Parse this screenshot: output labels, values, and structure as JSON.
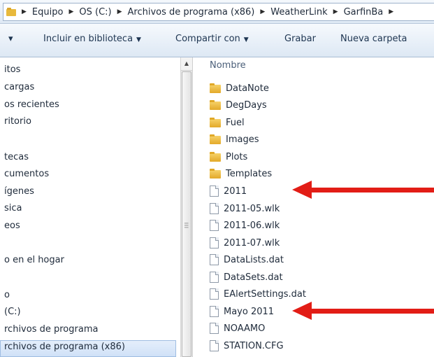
{
  "address_bar": {
    "crumbs": [
      "Equipo",
      "OS (C:)",
      "Archivos de programa (x86)",
      "WeatherLink",
      "GarfinBa"
    ]
  },
  "toolbar": {
    "organize_arrow": "▾",
    "include_library": "Incluir en biblioteca",
    "share_with": "Compartir con",
    "burn": "Grabar",
    "new_folder": "Nueva carpeta"
  },
  "nav": {
    "items": [
      "itos",
      "cargas",
      "os recientes",
      "ritorio",
      "tecas",
      "cumentos",
      "ígenes",
      "sica",
      "eos",
      "o en el hogar",
      "o",
      "(C:)",
      "rchivos de programa",
      "rchivos de programa (x86)"
    ]
  },
  "file_list": {
    "column_name": "Nombre",
    "items": [
      {
        "name": "DataNote",
        "kind": "folder"
      },
      {
        "name": "DegDays",
        "kind": "folder"
      },
      {
        "name": "Fuel",
        "kind": "folder"
      },
      {
        "name": "Images",
        "kind": "folder"
      },
      {
        "name": "Plots",
        "kind": "folder"
      },
      {
        "name": "Templates",
        "kind": "folder"
      },
      {
        "name": "2011",
        "kind": "file"
      },
      {
        "name": "2011-05.wlk",
        "kind": "file"
      },
      {
        "name": "2011-06.wlk",
        "kind": "file"
      },
      {
        "name": "2011-07.wlk",
        "kind": "file"
      },
      {
        "name": "DataLists.dat",
        "kind": "file"
      },
      {
        "name": "DataSets.dat",
        "kind": "file"
      },
      {
        "name": "EAlertSettings.dat",
        "kind": "file"
      },
      {
        "name": "Mayo 2011",
        "kind": "file"
      },
      {
        "name": "NOAAMO",
        "kind": "file"
      },
      {
        "name": "STATION.CFG",
        "kind": "file"
      }
    ]
  },
  "colors": {
    "annotation_arrow": "#e21d16",
    "folder": "#e8b93b",
    "selection": "#d0e1f7"
  },
  "icons": {
    "folder": "folder-icon",
    "file": "file-icon",
    "breadcrumb_separator": "chevron-right-icon"
  }
}
